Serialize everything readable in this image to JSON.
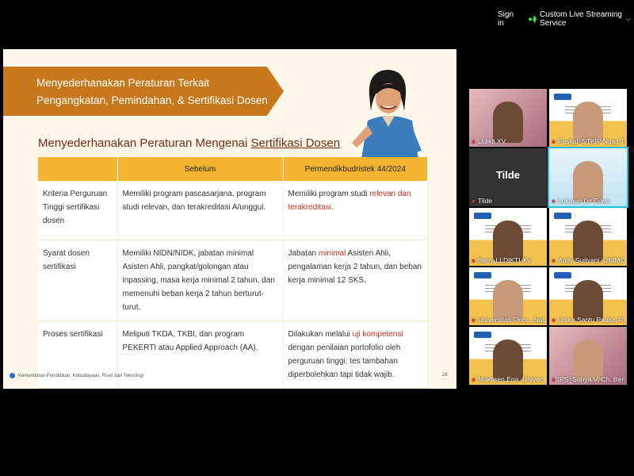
{
  "topbar": {
    "signin": "Sign in",
    "live_label": "Custom Live Streaming Service",
    "live_icon": "broadcast-icon",
    "chevron_icon": "chevron-down-icon"
  },
  "slide": {
    "banner_line1": "Menyederhanakan Peraturan Terkait",
    "banner_line2": "Pengangkatan, Pemindahan, & Sertifikasi Dosen",
    "section_title_prefix": "Menyederhanakan Peraturan Mengenai ",
    "section_title_underlined": "Sertifikasi Dosen",
    "table": {
      "headers": [
        "",
        "Sebelum",
        "Permendikbudristek 44/2024"
      ],
      "rows": [
        {
          "category": "Kriteria Perguruan Tinggi sertifikasi dosen",
          "before": "Memiliki program pascasarjana, program studi relevan, dan terakreditasi A/unggul.",
          "after_pre": "Memiliki program studi ",
          "after_hl": "relevan dan terakreditasi.",
          "after_post": ""
        },
        {
          "category": "Syarat dosen sertifikasi",
          "before": "Memiliki NIDN/NIDK, jabatan minimal Asisten Ahli, pangkat/golongan atau inpassing, masa kerja minimal 2 tahun, dan memenuhi beban kerja 2 tahun berturut-turut.",
          "after_pre": "Jabatan ",
          "after_hl": "minimal",
          "after_post": " Asisten Ahli, pengalaman kerja 2 tahun, dan beban kerja minimal 12 SKS."
        },
        {
          "category": "Proses sertifikasi",
          "before": "Meliputi TKDA, TKBI, dan program PEKERTI atau Applied Approach (AA).",
          "after_pre": "Dilakukan melalui ",
          "after_hl": "uji kompetensi",
          "after_post": " dengan penilaian portofolio oleh perguruan tinggi; tes tambahan diperbolehkan tapi tidak wajib."
        }
      ]
    },
    "footer": "Kementerian Pendidikan, Kebudayaan, Riset dan Teknologi",
    "page_number": "28"
  },
  "participants": [
    {
      "name": "Lldikti XV",
      "type": "pink"
    },
    {
      "name": "Paskal_STKIP Nusa Tim...",
      "type": "slide"
    },
    {
      "name": "Tilde",
      "type": "avatar",
      "big": "Tilde"
    },
    {
      "name": "Lukman Dir Daya",
      "type": "sister",
      "active": true
    },
    {
      "name": "Berry LLDIKTI XV",
      "type": "slide"
    },
    {
      "name": "Andy Suriyani_UNIMOF",
      "type": "slide"
    },
    {
      "name": "Universitas Flore...Nat...",
      "type": "slide"
    },
    {
      "name": "Unika Santu Paulus Ru...",
      "type": "slide"
    },
    {
      "name": "Maktisen Ena_Universi...",
      "type": "slide"
    },
    {
      "name": "IPS_Sonya V. Ch. Benu",
      "type": "pink"
    }
  ],
  "colors": {
    "banner": "#c8781c",
    "table_header": "#f4b531",
    "highlight": "#c0301d",
    "title": "#7a2a12",
    "active_outline": "#21c0e0"
  }
}
